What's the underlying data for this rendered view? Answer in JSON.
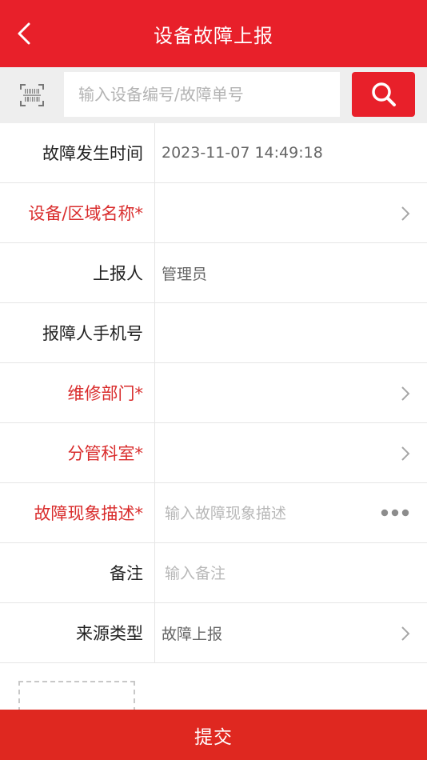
{
  "header": {
    "title": "设备故障上报"
  },
  "search": {
    "placeholder": "输入设备编号/故障单号",
    "value": ""
  },
  "form": {
    "rows": [
      {
        "label": "故障发生时间",
        "value": "2023-11-07 14:49:18"
      },
      {
        "label": "设备/区域名称*",
        "value": ""
      },
      {
        "label": "上报人",
        "value": "管理员"
      },
      {
        "label": "报障人手机号",
        "value": ""
      },
      {
        "label": "维修部门*",
        "value": ""
      },
      {
        "label": "分管科室*",
        "value": ""
      },
      {
        "label": "故障现象描述*",
        "placeholder": "输入故障现象描述"
      },
      {
        "label": "备注",
        "placeholder": "输入备注"
      },
      {
        "label": "来源类型",
        "value": "故障上报"
      }
    ]
  },
  "submit": {
    "label": "提交"
  },
  "colors": {
    "brand": "#e8202a",
    "required": "#d92c2c"
  },
  "icons": {
    "back": "chevron-left-icon",
    "scan": "barcode-scan-icon",
    "search": "search-icon",
    "chevron": "chevron-right-icon",
    "more": "ellipsis-icon"
  }
}
